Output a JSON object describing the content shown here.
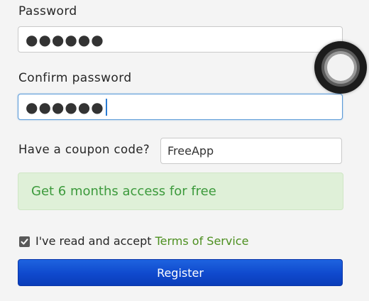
{
  "form": {
    "password": {
      "label": "Password",
      "masked_value": "●●●●●●"
    },
    "confirm_password": {
      "label": "Confirm password",
      "masked_value": "●●●●●●"
    },
    "coupon": {
      "label": "Have a coupon code?",
      "value": "FreeApp"
    },
    "promo_message": "Get 6 months access for free",
    "terms": {
      "checked": true,
      "text": "I've read and accept ",
      "link_text": "Terms of Service"
    },
    "register_label": "Register"
  },
  "overlay": {
    "icon": "assistive-touch-icon"
  },
  "colors": {
    "background": "#f4f4f4",
    "promo_bg": "#dff0d8",
    "promo_text": "#3c9a3c",
    "link": "#4c8f1f",
    "button": "#0f49cd",
    "focus_border": "#5b9ad8"
  }
}
